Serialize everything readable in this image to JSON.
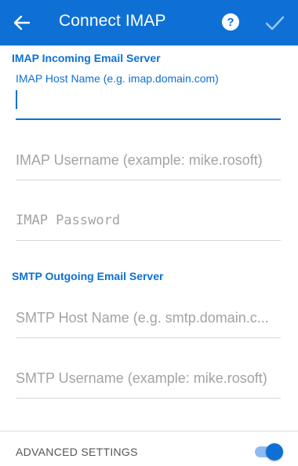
{
  "app_bar": {
    "title": "Connect IMAP",
    "background": "#0e70d4",
    "back_icon": "arrow-left-icon",
    "help_icon": "help-circle-icon",
    "confirm_icon": "checkmark-icon"
  },
  "incoming": {
    "header": "IMAP Incoming Email Server",
    "host": {
      "label": "IMAP Host Name (e.g. imap.domain.com)",
      "value": ""
    },
    "username": {
      "placeholder": "IMAP Username (example: mike.rosoft)",
      "value": ""
    },
    "password": {
      "placeholder": "IMAP Password",
      "value": ""
    }
  },
  "outgoing": {
    "header": "SMTP Outgoing Email Server",
    "host": {
      "placeholder": "SMTP Host Name (e.g. smtp.domain.c...",
      "value": ""
    },
    "username": {
      "placeholder": "SMTP Username (example: mike.rosoft)",
      "value": ""
    }
  },
  "advanced": {
    "label": "ADVANCED SETTINGS",
    "enabled": true,
    "accent": "#0e70d4"
  }
}
